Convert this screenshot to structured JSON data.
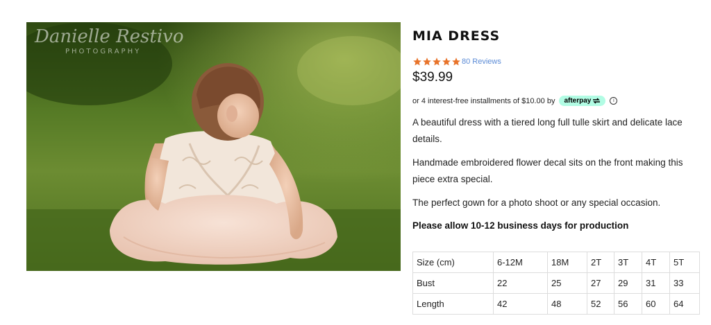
{
  "photo": {
    "watermark_name": "Danielle Restivo",
    "watermark_sub": "PHOTOGRAPHY"
  },
  "product": {
    "title": "MIA DRESS",
    "stars": 5,
    "star_color": "#e8732a",
    "reviews": "80 Reviews",
    "price": "$39.99",
    "afterpay_text": "or 4 interest-free installments of $10.00 by",
    "afterpay_brand": "afterpay",
    "afterpay_color": "#b2fce4",
    "info_icon": "ⓘ",
    "description": [
      "A beautiful dress with a tiered long full tulle skirt and delicate lace details.",
      "Handmade embroidered flower decal sits on the front making this piece extra special.",
      "The perfect gown for a photo shoot or any special occasion."
    ],
    "production_note": "Please allow 10-12 business days for production"
  },
  "size_table": {
    "rows": [
      [
        "Size (cm)",
        "6-12M",
        "18M",
        "2T",
        "3T",
        "4T",
        "5T"
      ],
      [
        "Bust",
        "22",
        "25",
        "27",
        "29",
        "31",
        "33"
      ],
      [
        "Length",
        "42",
        "48",
        "52",
        "56",
        "60",
        "64"
      ]
    ]
  }
}
